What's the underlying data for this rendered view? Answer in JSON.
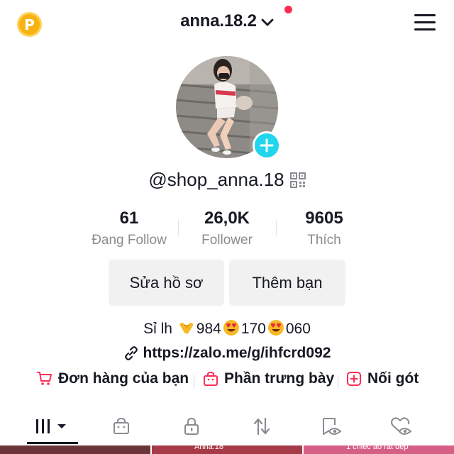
{
  "header": {
    "coin_letter": "P",
    "account_name": "anna.18.2",
    "notification_color": "#fe2c55"
  },
  "profile": {
    "handle": "@shop_anna.18",
    "add_icon": "plus-icon",
    "accent": "#20d5ec"
  },
  "stats": [
    {
      "value": "61",
      "label": "Đang Follow"
    },
    {
      "value": "26,0K",
      "label": "Follower"
    },
    {
      "value": "9605",
      "label": "Thích"
    }
  ],
  "buttons": {
    "edit_profile": "Sửa hồ sơ",
    "add_friends": "Thêm bạn"
  },
  "bio": {
    "prefix": "Sỉ lh ",
    "part1": "984",
    "part2": "170",
    "part3": "060",
    "emojis": [
      "heart-hands-emoji",
      "heart-eyes-emoji",
      "heart-eyes-emoji"
    ],
    "link": "https://zalo.me/g/ihfcrd092"
  },
  "actions": [
    {
      "label": "Đơn hàng của bạn",
      "icon": "cart-icon"
    },
    {
      "label": "Phần trưng bày",
      "icon": "shop-bag-icon"
    },
    {
      "label": "Nối gót",
      "icon": "add-square-icon"
    }
  ],
  "tabs": [
    {
      "icon": "grid-icon",
      "active": true
    },
    {
      "icon": "shop-bag-icon"
    },
    {
      "icon": "lock-icon"
    },
    {
      "icon": "repost-icon"
    },
    {
      "icon": "bookmark-eye-icon"
    },
    {
      "icon": "liked-eye-icon"
    }
  ],
  "thumbnails": [
    {
      "caption": ""
    },
    {
      "caption": "Anna.18"
    },
    {
      "caption": "1 chiếc áo rất đẹp"
    }
  ]
}
